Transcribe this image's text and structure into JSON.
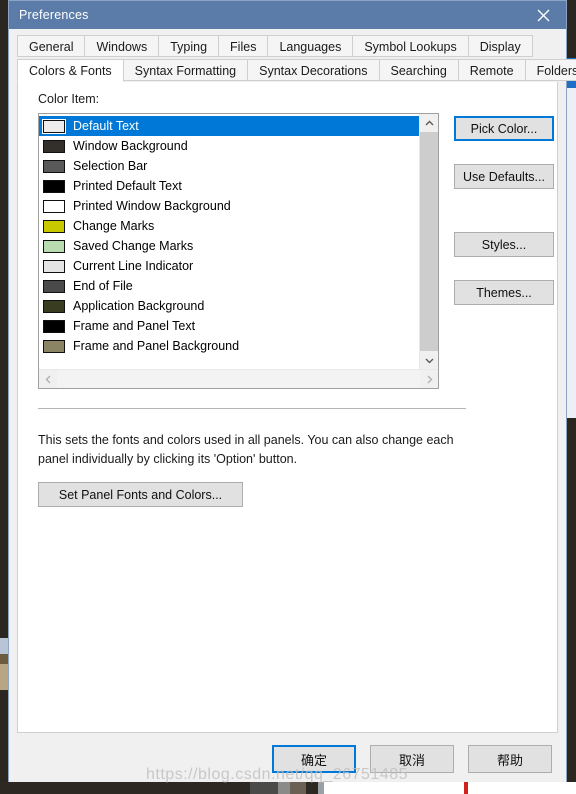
{
  "window": {
    "title": "Preferences",
    "close_icon": "close-icon"
  },
  "tabs": {
    "row1": [
      {
        "label": "General",
        "active": false
      },
      {
        "label": "Windows",
        "active": false
      },
      {
        "label": "Typing",
        "active": false
      },
      {
        "label": "Files",
        "active": false
      },
      {
        "label": "Languages",
        "active": false
      },
      {
        "label": "Symbol Lookups",
        "active": false
      },
      {
        "label": "Display",
        "active": false
      }
    ],
    "row2": [
      {
        "label": "Colors & Fonts",
        "active": true
      },
      {
        "label": "Syntax Formatting",
        "active": false
      },
      {
        "label": "Syntax Decorations",
        "active": false
      },
      {
        "label": "Searching",
        "active": false
      },
      {
        "label": "Remote",
        "active": false
      },
      {
        "label": "Folders",
        "active": false
      }
    ]
  },
  "panel": {
    "color_item_label": "Color Item:",
    "selection_color": "#0078d7",
    "items": [
      {
        "label": "Default Text",
        "color": "#ededed",
        "selected": true
      },
      {
        "label": "Window Background",
        "color": "#332f2b",
        "selected": false
      },
      {
        "label": "Selection Bar",
        "color": "#595959",
        "selected": false
      },
      {
        "label": "Printed Default Text",
        "color": "#000000",
        "selected": false
      },
      {
        "label": "Printed Window Background",
        "color": "#ffffff",
        "selected": false
      },
      {
        "label": "Change Marks",
        "color": "#c8c800",
        "selected": false
      },
      {
        "label": "Saved Change Marks",
        "color": "#b8dcb0",
        "selected": false
      },
      {
        "label": "Current Line Indicator",
        "color": "#e4e4e4",
        "selected": false
      },
      {
        "label": "End of File",
        "color": "#4a4a4a",
        "selected": false
      },
      {
        "label": "Application Background",
        "color": "#3a3c22",
        "selected": false
      },
      {
        "label": "Frame and Panel Text",
        "color": "#000000",
        "selected": false
      },
      {
        "label": "Frame and Panel Background",
        "color": "#8a8464",
        "selected": false
      }
    ],
    "buttons": {
      "pick_color": "Pick Color...",
      "use_defaults": "Use Defaults...",
      "styles": "Styles...",
      "themes": "Themes...",
      "set_panel_fonts": "Set Panel Fonts and Colors..."
    },
    "description": "This sets the fonts and colors used in all panels. You can also change each panel individually by clicking its 'Option' button."
  },
  "footer": {
    "ok": "确定",
    "cancel": "取消",
    "help": "帮助"
  },
  "watermark": {
    "text": "https://blog.csdn.net/qq_26751485"
  }
}
